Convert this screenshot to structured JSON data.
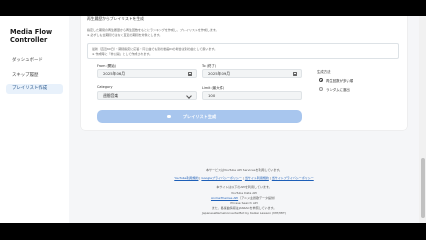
{
  "sidebar": {
    "brand_line1": "Media Flow",
    "brand_line2": "Controller",
    "items": [
      {
        "label": "ダッシュボード"
      },
      {
        "label": "スキップ履歴"
      },
      {
        "label": "プレイリスト作成"
      }
    ],
    "active_index": 2
  },
  "form": {
    "heading": "再生履歴からプレイリストを生成",
    "desc_line1": "指定した期間の再生履歴から再生回数をもとにランキングを作成し、プレイリストを作成します。",
    "desc_line2": "※ 必ずしも全期間ではなく直近の期間を対象にします。",
    "notice_line1": "最新（直近60日）・期間指定に応答・同じ曲でも別の動画IDの場合は別の曲として扱います。",
    "notice_line2": "※ 作成時に「非公開」として作成されます。",
    "from_label": "From (開始)",
    "from_value": "2025年06月",
    "to_label": "To (終了)",
    "to_value": "2025年09月",
    "category_label": "Category",
    "category_value": "週間音楽",
    "limit_label": "Limit (最大件)",
    "limit_value": "100",
    "method_label": "生成方法",
    "method_options": [
      "再生回数が多い順",
      "ランダムに選出"
    ],
    "method_selected": 0,
    "generate_label": "プレイリスト生成"
  },
  "footer": {
    "line1": "本サービスはYouTube API Servicesを利用しています。",
    "link1": "YouTube利用規約",
    "link2": "Googleプライバシーポリシー",
    "link3": "当サイト利用規約",
    "link4": "当サイトプライバシーポリシー",
    "line3": "本サイトは以下のAPIを利用しています。",
    "line4": "YouTube Data API",
    "line5_link": "AnimeThemes API",
    "line5_text": "（アニメ主題歌データ提供）",
    "line6": "Phrase Search API",
    "line7": "また、各楽曲情報はJASRACを参照しています。",
    "line8": "JapaneseNameConverterBot by Kaikei Lawson (MIT/MIT)"
  },
  "colors": {
    "accent": "#1e4f86",
    "button": "#a8c6ee",
    "link": "#1d5fb8"
  }
}
